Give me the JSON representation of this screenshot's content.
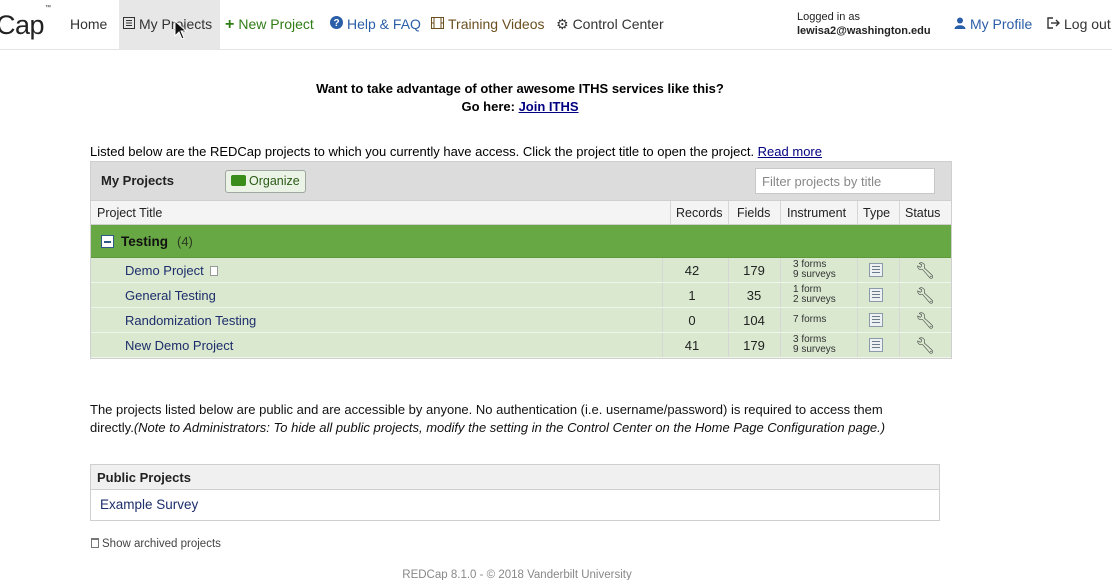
{
  "nav": {
    "brand": "Cap",
    "brand_tm": "™",
    "home": "Home",
    "my_projects": "My Projects",
    "new_project": "New Project",
    "help": "Help & FAQ",
    "training": "Training Videos",
    "control_center": "Control Center",
    "logged_in_label": "Logged in as",
    "username": "lewisa2@washington.edu",
    "my_profile": "My Profile",
    "logout": "Log out"
  },
  "promo": {
    "line1": "Want to take advantage of other awesome ITHS services like this?",
    "line2_prefix": "Go here: ",
    "link": "Join ITHS"
  },
  "intro": {
    "text": "Listed below are the REDCap projects to which you currently have access. Click the project title to open the project. ",
    "link": "Read more"
  },
  "my_projects": {
    "title": "My Projects",
    "organize": "Organize",
    "filter_placeholder": "Filter projects by title",
    "columns": {
      "title": "Project Title",
      "records": "Records",
      "fields": "Fields",
      "instrument": "Instrument",
      "type": "Type",
      "status": "Status"
    },
    "group": {
      "name": "Testing",
      "count": "(4)"
    },
    "rows": [
      {
        "title": "Demo Project",
        "records": "42",
        "fields": "179",
        "inst1": "3 forms",
        "inst2": "9 surveys"
      },
      {
        "title": "General Testing",
        "records": "1",
        "fields": "35",
        "inst1": "1 form",
        "inst2": "2 surveys"
      },
      {
        "title": "Randomization Testing",
        "records": "0",
        "fields": "104",
        "inst1": "7 forms",
        "inst2": ""
      },
      {
        "title": "New Demo Project",
        "records": "41",
        "fields": "179",
        "inst1": "3 forms",
        "inst2": "9 surveys"
      }
    ]
  },
  "public_note": {
    "text": "The projects listed below are public and are accessible by anyone. No authentication (i.e. username/password) is required to access them directly.",
    "italic": "(Note to Administrators: To hide all public projects, modify the setting in the Control Center on the Home Page Configuration page.)"
  },
  "public_projects": {
    "title": "Public Projects",
    "item": "Example Survey"
  },
  "archived": "Show archived projects",
  "footer": "REDCap 8.1.0 - © 2018 Vanderbilt University"
}
